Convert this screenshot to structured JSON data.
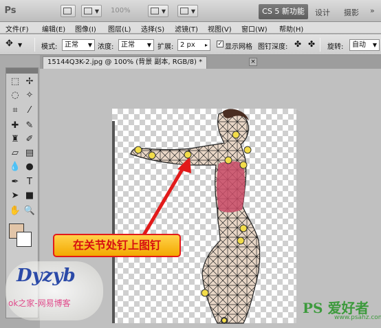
{
  "app": {
    "logo": "Ps",
    "zoom": "100%",
    "workspaces": [
      "CS 5 新功能",
      "设计",
      "摄影"
    ],
    "workspaces_more": "»"
  },
  "menu": [
    "文件(F)",
    "编辑(E)",
    "图像(I)",
    "图层(L)",
    "选择(S)",
    "滤镜(T)",
    "视图(V)",
    "窗口(W)",
    "帮助(H)"
  ],
  "options": {
    "mode_label": "模式:",
    "mode_value": "正常",
    "density_label": "浓度:",
    "density_value": "正常",
    "expand_label": "扩展:",
    "expand_value": "2 px",
    "show_mesh_label": "显示网格",
    "show_mesh_checked": "✓",
    "pin_depth_label": "图钉深度:",
    "rotate_label": "旋转:",
    "rotate_value": "自动"
  },
  "document": {
    "tab_title": "15144Q3K-2.jpg @ 100% (背景 副本, RGB/8) *",
    "close": "×"
  },
  "callout": "在关节处钉上图钉",
  "watermarks": {
    "left_logo": "Dyzyb",
    "left_text": "ok之家-网易博客",
    "right_logo": "PS 爱好者",
    "right_url": "www.psahz.com"
  },
  "colors": {
    "foreground": "#e2c5a8",
    "background": "#ffffff",
    "arrow": "#e21a1a",
    "pin": "#f2dc4a"
  },
  "tool_icons": [
    "move-icon",
    "marquee-icon",
    "lasso-icon",
    "magic-wand-icon",
    "crop-icon",
    "eyedropper-icon",
    "healing-icon",
    "brush-icon",
    "clone-stamp-icon",
    "history-brush-icon",
    "eraser-icon",
    "gradient-icon",
    "blur-icon",
    "dodge-icon",
    "pen-icon",
    "type-icon",
    "path-select-icon",
    "shape-icon",
    "hand-icon",
    "zoom-icon"
  ]
}
